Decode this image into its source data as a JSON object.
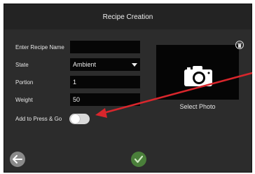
{
  "header": {
    "title": "Recipe Creation"
  },
  "form": {
    "name_label": "Enter Recipe Name",
    "name_value": "",
    "state_label": "State",
    "state_value": "Ambient",
    "portion_label": "Portion",
    "portion_value": "1",
    "weight_label": "Weight",
    "weight_value": "50",
    "press_go_label": "Add to Press & Go",
    "press_go_on": false
  },
  "photo": {
    "label": "Select Photo"
  },
  "colors": {
    "panel": "#2c2c2c",
    "titlebar": "#232323",
    "field": "#060606",
    "confirm": "#4a7f3a",
    "annotation_arrow": "#d9262c"
  },
  "icons": {
    "back": "arrow-left-icon",
    "confirm": "checkmark-icon",
    "camera": "camera-icon",
    "delete": "trash-icon"
  }
}
